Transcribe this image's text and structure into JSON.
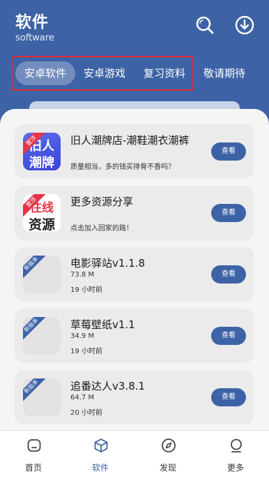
{
  "header": {
    "title": "软件",
    "subtitle": "software",
    "icons": [
      "search-icon",
      "download-icon"
    ]
  },
  "tabs": [
    {
      "label": "安卓软件",
      "active": true
    },
    {
      "label": "安卓游戏",
      "active": false
    },
    {
      "label": "复习资料",
      "active": false
    },
    {
      "label": "敬请期待",
      "active": false
    }
  ],
  "apps": [
    {
      "name": "旧人潮牌店-潮鞋潮衣潮裤",
      "description": "质量相当，多的钱买排骨不香吗？",
      "button": "查看",
      "ribbon": "置顶",
      "logo_line1": "旧人",
      "logo_line2": "潮牌"
    },
    {
      "name": "更多资源分享",
      "description": "点击加入回家的路！",
      "button": "查看",
      "ribbon": "置顶",
      "logo_line1": "往线",
      "logo_line2": "资源"
    },
    {
      "name": "电影驿站v1.1.8",
      "size": "73.8 M",
      "time": "19 小时前",
      "button": "查看",
      "ribbon": "新版本"
    },
    {
      "name": "草莓壁纸v1.1",
      "size": "34.9 M",
      "time": "19 小时前",
      "button": "查看",
      "ribbon": "新版本"
    },
    {
      "name": "追番达人v3.8.1",
      "size": "64.7 M",
      "time": "20 小时前",
      "button": "查看",
      "ribbon": "新版本"
    }
  ],
  "bottom_nav": [
    {
      "label": "首页",
      "icon": "home-icon",
      "active": false
    },
    {
      "label": "软件",
      "icon": "cube-icon",
      "active": true
    },
    {
      "label": "发现",
      "icon": "compass-icon",
      "active": false
    },
    {
      "label": "更多",
      "icon": "more-icon",
      "active": false
    }
  ],
  "colors": {
    "primary": "#3d63a6",
    "highlight_border": "#e02b2b",
    "ribbon_red": "#e6354a"
  }
}
